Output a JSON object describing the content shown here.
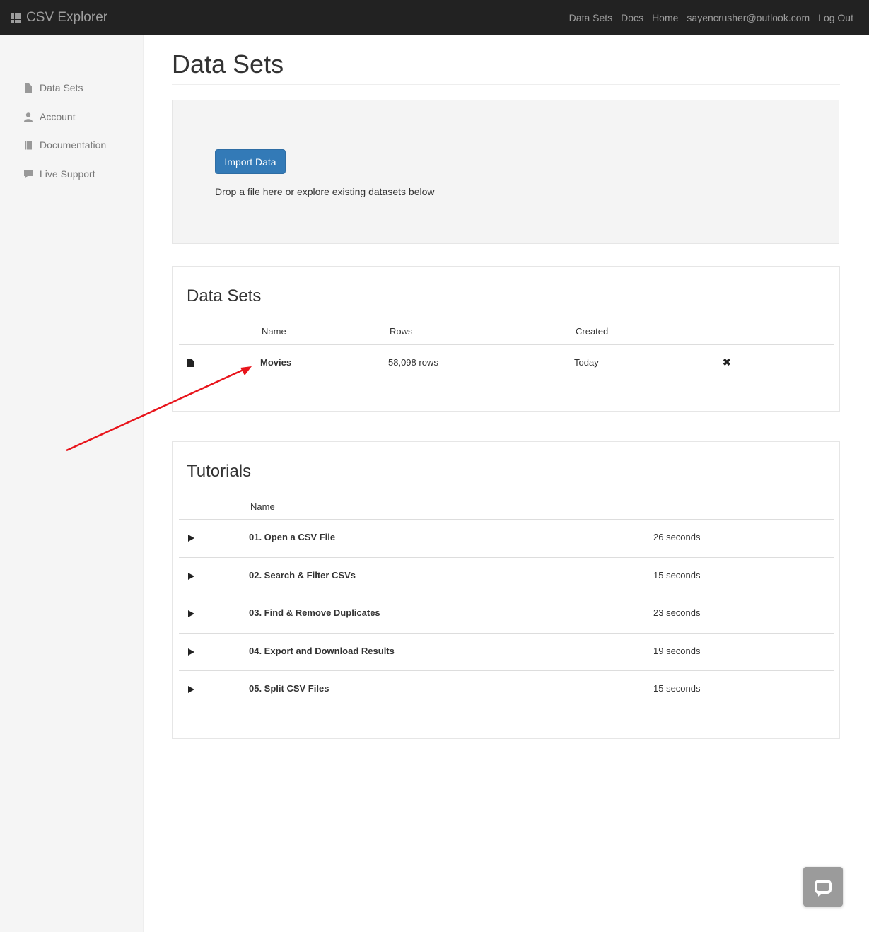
{
  "navbar": {
    "brand": "CSV Explorer",
    "links": [
      "Data Sets",
      "Docs",
      "Home",
      "sayencrusher@outlook.com",
      "Log Out"
    ]
  },
  "sidebar": {
    "items": [
      {
        "label": "Data Sets",
        "icon": "file-icon"
      },
      {
        "label": "Account",
        "icon": "user-icon"
      },
      {
        "label": "Documentation",
        "icon": "book-icon"
      },
      {
        "label": "Live Support",
        "icon": "comment-icon"
      }
    ]
  },
  "page": {
    "title": "Data Sets"
  },
  "import": {
    "button_label": "Import Data",
    "drop_text": "Drop a file here or explore existing datasets below"
  },
  "datasets": {
    "heading": "Data Sets",
    "columns": [
      "Name",
      "Rows",
      "Created"
    ],
    "rows": [
      {
        "name": "Movies",
        "rows": "58,098 rows",
        "created": "Today"
      }
    ]
  },
  "tutorials": {
    "heading": "Tutorials",
    "columns": [
      "Name"
    ],
    "rows": [
      {
        "name": "01. Open a CSV File",
        "duration": "26 seconds"
      },
      {
        "name": "02. Search & Filter CSVs",
        "duration": "15 seconds"
      },
      {
        "name": "03. Find & Remove Duplicates",
        "duration": "23 seconds"
      },
      {
        "name": "04. Export and Download Results",
        "duration": "19 seconds"
      },
      {
        "name": "05. Split CSV Files",
        "duration": "15 seconds"
      }
    ]
  },
  "colors": {
    "navbar_bg": "#222222",
    "primary": "#337ab7",
    "annotation_arrow": "#e8141b"
  }
}
